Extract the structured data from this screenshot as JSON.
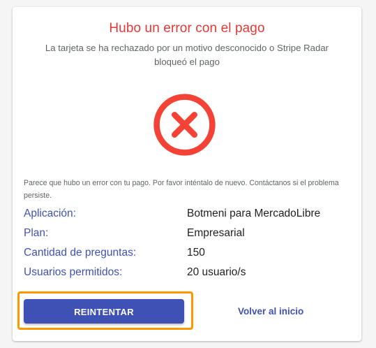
{
  "header": {
    "title": "Hubo un error con el pago",
    "subtitle": "La tarjeta se ha rechazado por un motivo desconocido o Stripe Radar bloqueó el pago"
  },
  "icon": {
    "name": "error-x-icon",
    "color": "#f44336"
  },
  "message": "Parece que hubo un error con tu pago. Por favor inténtalo de nuevo. Contáctanos si el problema persiste.",
  "details": [
    {
      "label": "Aplicación:",
      "value": "Botmeni para MercadoLibre"
    },
    {
      "label": "Plan:",
      "value": "Empresarial"
    },
    {
      "label": "Cantidad de preguntas:",
      "value": "150"
    },
    {
      "label": "Usuarios permitidos:",
      "value": "20 usuario/s"
    }
  ],
  "actions": {
    "retry_label": "REINTENTAR",
    "home_label": "Volver al inicio"
  },
  "colors": {
    "error": "#e53935",
    "primary": "#3f51b5",
    "highlight": "#ff9800"
  }
}
